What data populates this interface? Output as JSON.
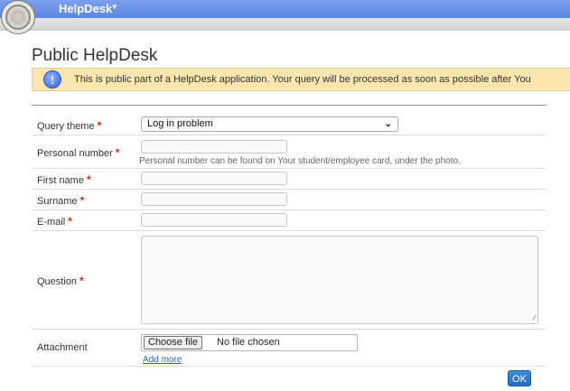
{
  "header": {
    "app_title": "HelpDesk",
    "menu_caret": "▾"
  },
  "page": {
    "title": "Public HelpDesk",
    "info_text": "This is public part of a HelpDesk application. Your query will be processed as soon as possible after You"
  },
  "form": {
    "required_mark": "*",
    "query_theme": {
      "label": "Query theme",
      "selected": "Log in problem"
    },
    "personal_number": {
      "label": "Personal number",
      "value": "",
      "help": "Personal number can be found on Your student/employee card, under the photo."
    },
    "first_name": {
      "label": "First name",
      "value": ""
    },
    "surname": {
      "label": "Surname",
      "value": ""
    },
    "email": {
      "label": "E-mail",
      "value": ""
    },
    "question": {
      "label": "Question",
      "value": ""
    },
    "attachment": {
      "label": "Attachment",
      "button": "Choose file",
      "status": "No file chosen",
      "add_more": "Add more"
    },
    "submit": "OK"
  },
  "colors": {
    "topbar": "#5b86e2",
    "info_bg": "#fbe6b0",
    "required": "#d9261c",
    "link": "#2a63c7",
    "ok_button": "#1f6fc0"
  }
}
